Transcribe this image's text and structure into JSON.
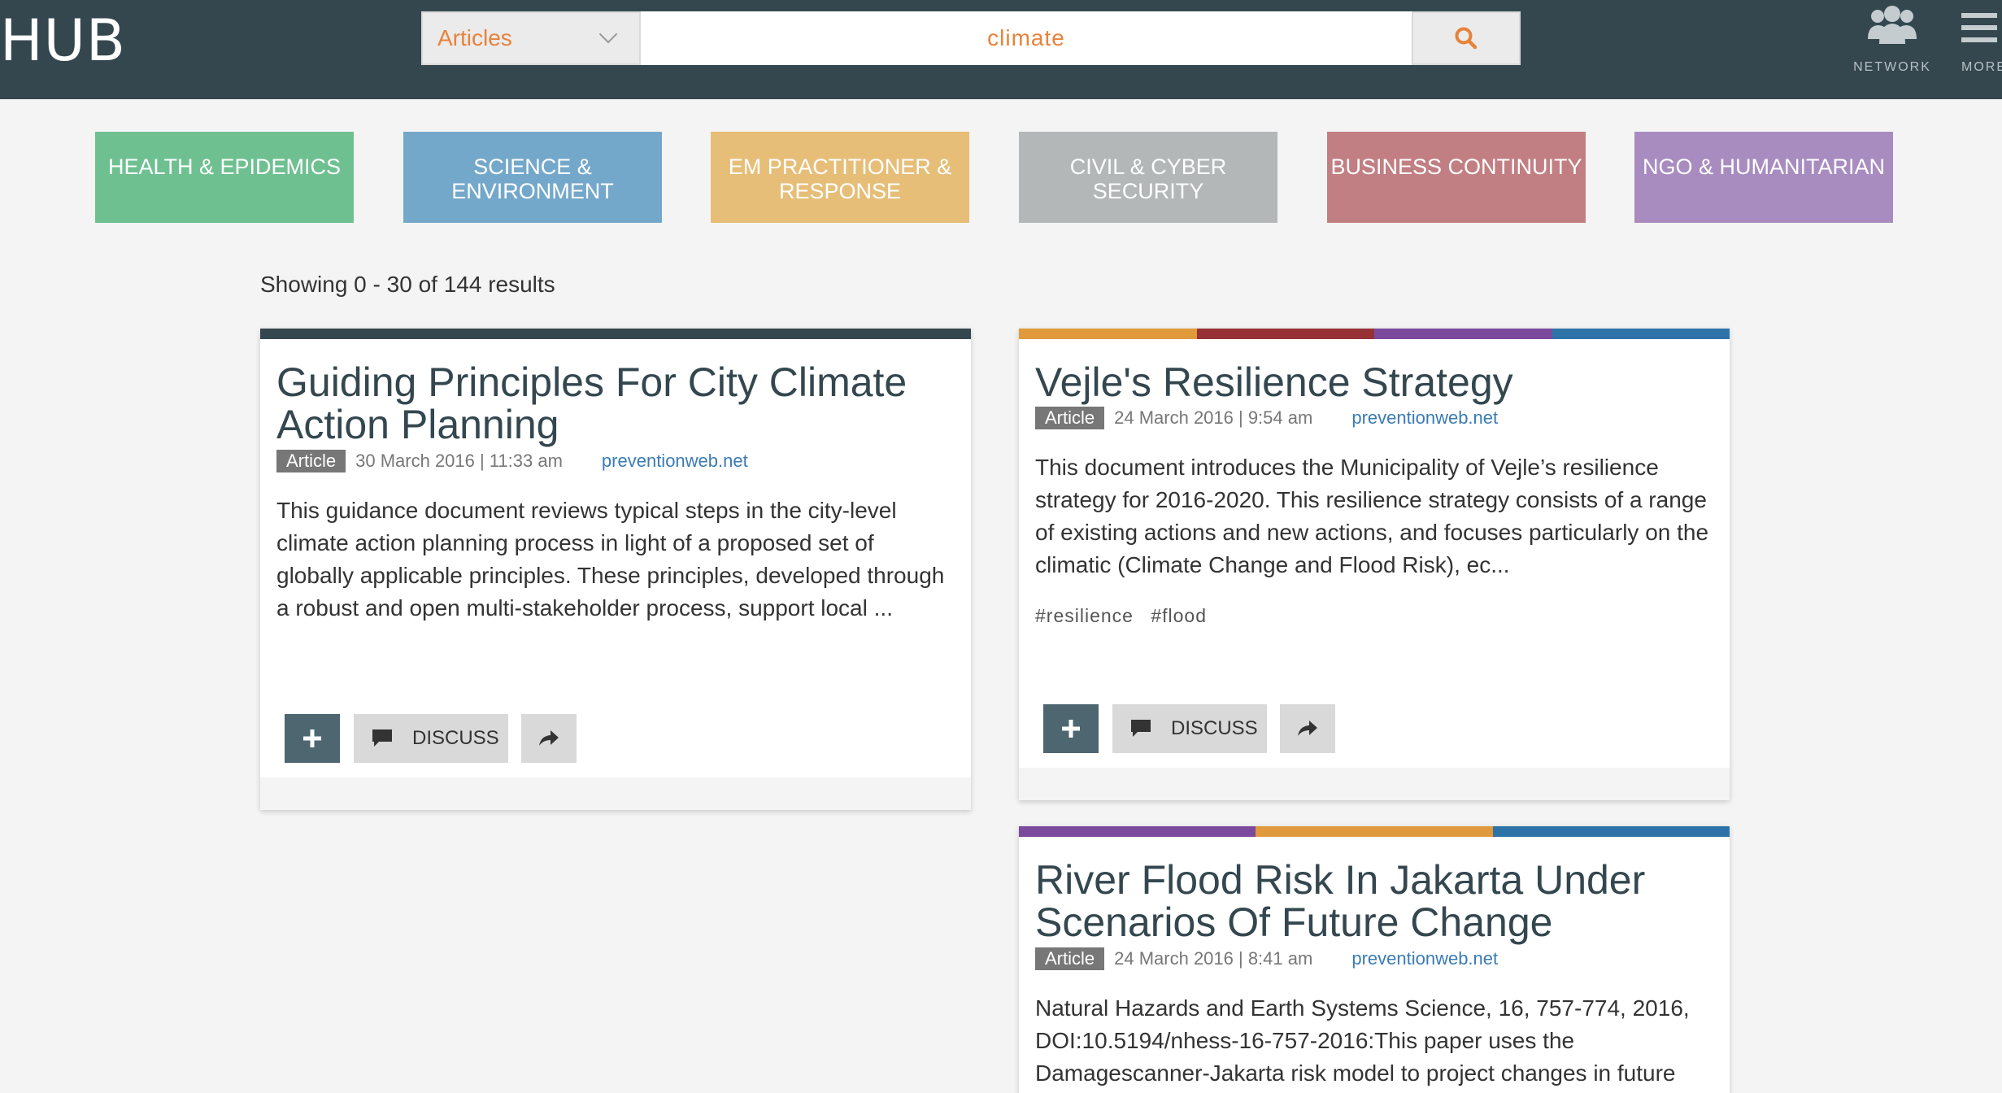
{
  "header": {
    "logo": "HUB",
    "search_type": "Articles",
    "search_query": "climate",
    "nav": [
      {
        "label": "NETWORK",
        "icon": "people-icon"
      },
      {
        "label": "MORE",
        "icon": "menu-icon"
      }
    ]
  },
  "categories": [
    {
      "label": "HEALTH & EPIDEMICS",
      "color": "#6fc091"
    },
    {
      "label": "SCIENCE & ENVIRONMENT",
      "color": "#74a8cb"
    },
    {
      "label": "EM PRACTITIONER & RESPONSE",
      "color": "#e6be78"
    },
    {
      "label": "CIVIL & CYBER SECURITY",
      "color": "#b3b7b7"
    },
    {
      "label": "BUSINESS CONTINUITY",
      "color": "#c27f83"
    },
    {
      "label": "NGO & HUMANITARIAN",
      "color": "#a88cc0"
    }
  ],
  "results_text": "Showing 0 - 30 of 144 results",
  "cards": [
    {
      "bar_colors": [
        "#34474f"
      ],
      "title": "Guiding Principles For City Climate Action Planning",
      "type": "Article",
      "date": "30 March 2016 | 11:33 am",
      "source": "preventionweb.net",
      "description": "This guidance document reviews typical steps in the city-level climate action planning process in light of a proposed set of globally applicable principles. These principles, developed through a robust and open multi-stakeholder process, support local ...",
      "tags": [],
      "discuss_label": "DISCUSS"
    },
    {
      "bar_colors": [
        "#e09a3b",
        "#963136",
        "#7b4a9c",
        "#2e73a8"
      ],
      "title": "Vejle's Resilience Strategy",
      "type": "Article",
      "date": "24 March 2016 | 9:54 am",
      "source": "preventionweb.net",
      "description": "This document introduces the Municipality of Vejle’s resilience strategy for 2016-2020. This resilience strategy consists of a range of existing actions and new actions, and focuses particularly on the climatic (Climate Change and Flood Risk), ec...",
      "tags": [
        "#resilience",
        "#flood"
      ],
      "discuss_label": "DISCUSS"
    },
    {
      "bar_colors": [
        "#7b4a9c",
        "#e09a3b",
        "#2e73a8"
      ],
      "title": "River Flood Risk In Jakarta Under Scenarios Of Future Change",
      "type": "Article",
      "date": "24 March 2016 | 8:41 am",
      "source": "preventionweb.net",
      "description": "Natural Hazards and Earth Systems Science, 16, 757-774, 2016, DOI:10.5194/nhess-16-757-2016:This paper uses the Damagescanner-Jakarta risk model to project changes in future",
      "tags": [],
      "discuss_label": "DISCUSS"
    }
  ]
}
